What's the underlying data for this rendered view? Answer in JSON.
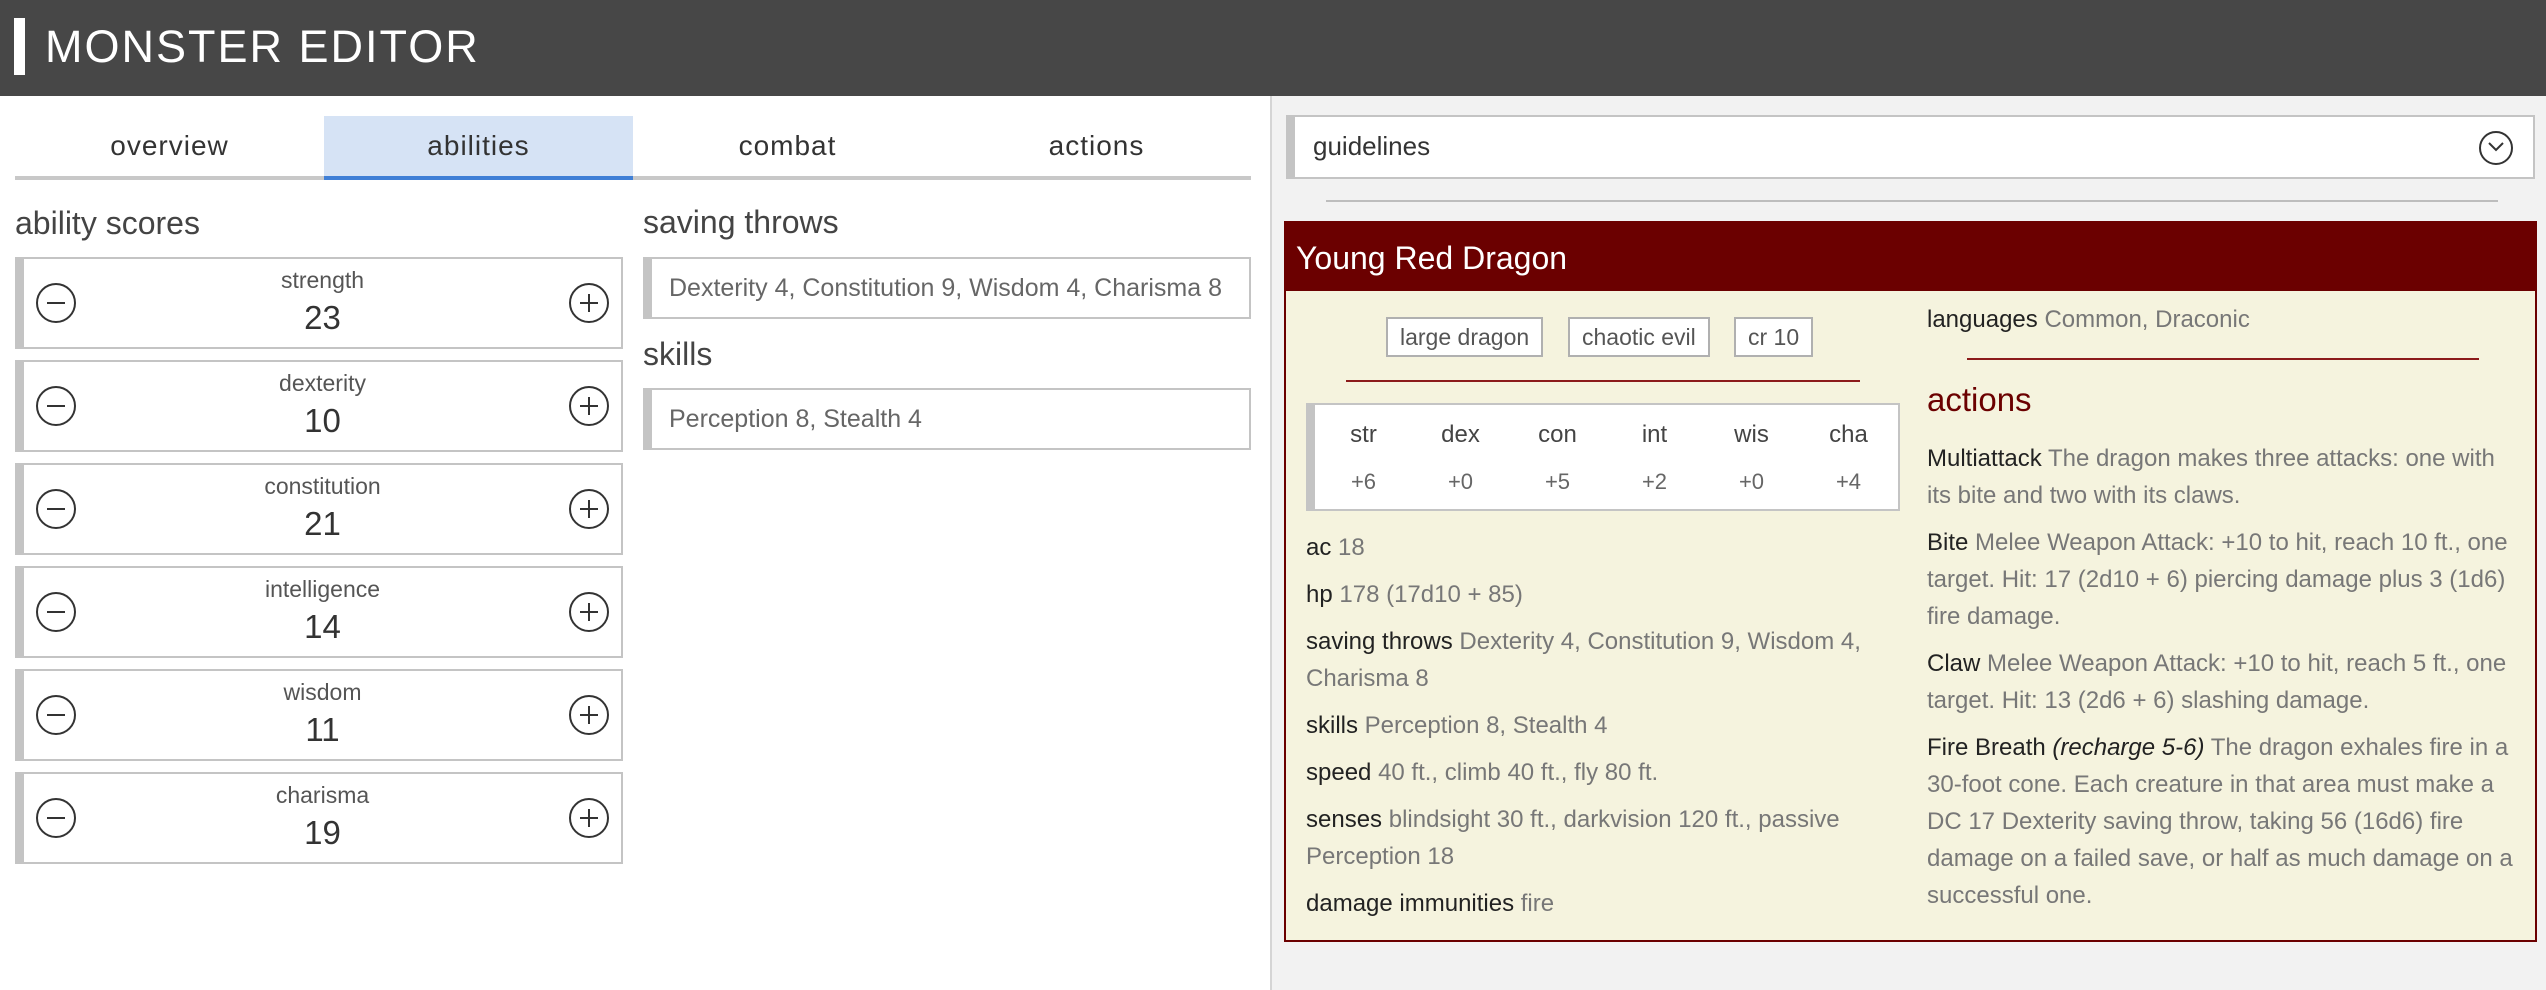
{
  "app": {
    "title": "MONSTER EDITOR"
  },
  "tabs": [
    {
      "label": "overview"
    },
    {
      "label": "abilities"
    },
    {
      "label": "combat"
    },
    {
      "label": "actions"
    }
  ],
  "active_tab": "abilities",
  "ability_scores": {
    "title": "ability scores",
    "items": [
      {
        "name": "strength",
        "value": "23"
      },
      {
        "name": "dexterity",
        "value": "10"
      },
      {
        "name": "constitution",
        "value": "21"
      },
      {
        "name": "intelligence",
        "value": "14"
      },
      {
        "name": "wisdom",
        "value": "11"
      },
      {
        "name": "charisma",
        "value": "19"
      }
    ]
  },
  "saving_throws": {
    "title": "saving throws",
    "value": "Dexterity 4, Constitution 9, Wisdom 4, Charisma 8"
  },
  "skills": {
    "title": "skills",
    "value": "Perception 8, Stealth 4"
  },
  "guidelines": {
    "label": "guidelines",
    "icon": "chevron-down-icon"
  },
  "stat_block": {
    "name": "Young Red Dragon",
    "tags": [
      "large dragon",
      "chaotic evil",
      "cr 10"
    ],
    "abilities": [
      {
        "label": "str",
        "mod": "+6"
      },
      {
        "label": "dex",
        "mod": "+0"
      },
      {
        "label": "con",
        "mod": "+5"
      },
      {
        "label": "int",
        "mod": "+2"
      },
      {
        "label": "wis",
        "mod": "+0"
      },
      {
        "label": "cha",
        "mod": "+4"
      }
    ],
    "ac": {
      "label": "ac",
      "value": "18"
    },
    "hp": {
      "label": "hp",
      "value": "178 (17d10 + 85)"
    },
    "saving_throws": {
      "label": "saving throws",
      "value": "Dexterity 4, Constitution 9, Wisdom 4, Charisma 8"
    },
    "skills": {
      "label": "skills",
      "value": "Perception 8, Stealth 4"
    },
    "speed": {
      "label": "speed",
      "value": "40 ft., climb 40 ft., fly 80 ft."
    },
    "senses": {
      "label": "senses",
      "value": "blindsight 30 ft., darkvision 120 ft., passive Perception 18"
    },
    "damage_immunities": {
      "label": "damage immunities",
      "value": "fire"
    },
    "languages": {
      "label": "languages",
      "value": "Common, Draconic"
    },
    "actions_title": "actions",
    "actions": [
      {
        "name": "Multiattack",
        "recharge": "",
        "text": "The dragon makes three attacks: one with its bite and two with its claws."
      },
      {
        "name": "Bite",
        "recharge": "",
        "text": "Melee Weapon Attack: +10 to hit, reach 10 ft., one target. Hit: 17 (2d10 + 6) piercing damage plus 3 (1d6) fire damage."
      },
      {
        "name": "Claw",
        "recharge": "",
        "text": "Melee Weapon Attack: +10 to hit, reach 5 ft., one target. Hit: 13 (2d6 + 6) slashing damage."
      },
      {
        "name": "Fire Breath",
        "recharge": "(recharge 5-6)",
        "text": "The dragon exhales fire in a 30-foot cone. Each creature in that area must make a DC 17 Dexterity saving throw, taking 56 (16d6) fire damage on a failed save, or half as much damage on a successful one."
      }
    ]
  },
  "colors": {
    "header_bg": "#474747",
    "active_tab_bg": "#d6e3f5",
    "active_tab_underline": "#3f7fd6",
    "stat_block_bg": "#f5f3de",
    "stat_block_accent": "#6b0000"
  }
}
